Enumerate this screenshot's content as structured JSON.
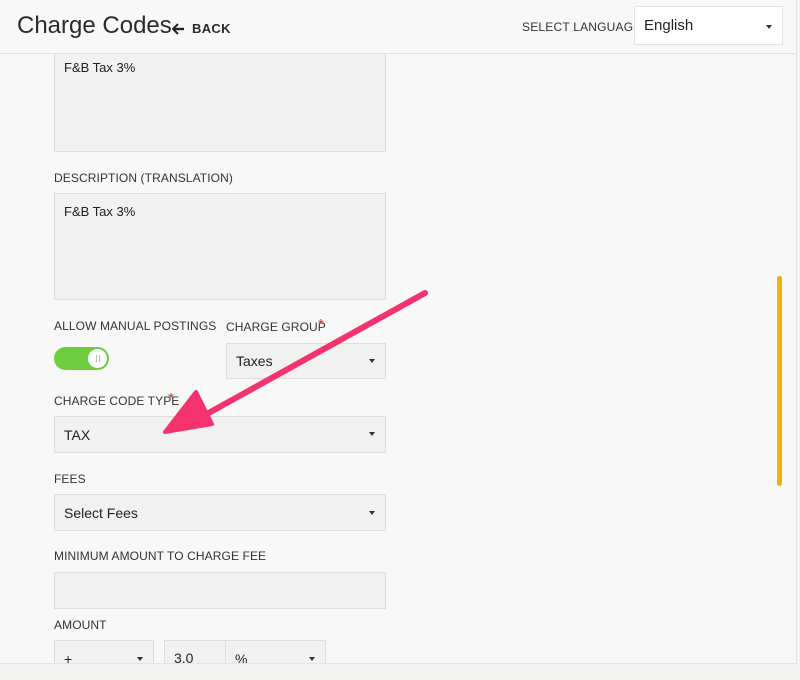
{
  "header": {
    "title": "Charge Codes",
    "back_label": "BACK",
    "language_label": "SELECT LANGUAGE",
    "language_value": "English"
  },
  "form": {
    "description_value": "F&B Tax 3%",
    "description_translation_label": "DESCRIPTION (TRANSLATION)",
    "description_translation_value": "F&B Tax 3%",
    "allow_manual_postings_label": "ALLOW MANUAL POSTINGS",
    "allow_manual_postings_on": true,
    "charge_group_label": "CHARGE GROUP",
    "charge_group_value": "Taxes",
    "charge_code_type_label": "CHARGE CODE TYPE",
    "charge_code_type_value": "TAX",
    "fees_label": "FEES",
    "fees_value": "Select Fees",
    "minimum_amount_label": "MINIMUM AMOUNT TO CHARGE FEE",
    "minimum_amount_value": "",
    "amount_label": "AMOUNT",
    "amount_sign_value": "+",
    "amount_value": "3.0",
    "amount_unit_value": "%",
    "required_marker": "*"
  },
  "annotation": {
    "arrow_color": "#f4326e",
    "arrow_icon": "arrow-pointing-to-charge-code-type"
  },
  "colors": {
    "toggle_on": "#6dcd3e",
    "scrollbar": "#f2b20c",
    "required": "#d9302c"
  }
}
